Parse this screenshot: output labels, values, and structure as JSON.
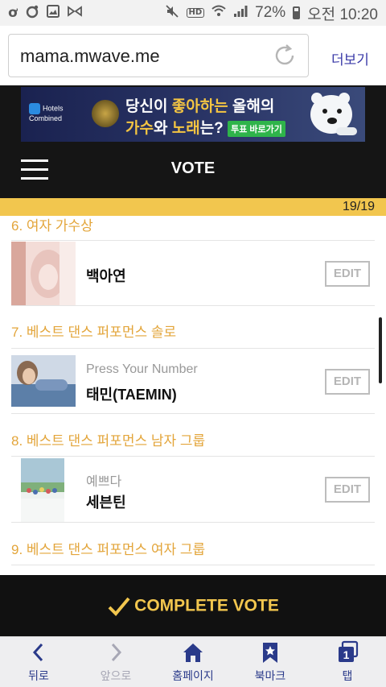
{
  "status_bar": {
    "battery": "72%",
    "time": "오전 10:20",
    "icons": [
      "o-icon",
      "circle-dot-icon",
      "image-icon",
      "bowtie-icon",
      "mute-icon",
      "hd-icon",
      "wifi-icon",
      "signal-icon",
      "battery-icon"
    ]
  },
  "browser": {
    "url": "mama.mwave.me",
    "more_label": "더보기"
  },
  "banner": {
    "hc_brand": "Hotels Combined",
    "line1_prefix": "당신이 ",
    "line1_highlight": "좋아하는",
    "line1_suffix": " 올해의",
    "line2_highlight1": "가수",
    "line2_mid": "와 ",
    "line2_highlight2": "노래",
    "line2_suffix": "는?",
    "button_label": "투표 바로가기"
  },
  "header": {
    "title": "VOTE"
  },
  "progress": {
    "text": "19/19"
  },
  "categories": [
    {
      "label": "6.  여자 가수상"
    },
    {
      "label": "7.  베스트 댄스 퍼포먼스 솔로"
    },
    {
      "label": "8.  베스트 댄스 퍼포먼스 남자 그룹"
    },
    {
      "label": "9.  베스트 댄스 퍼포먼스 여자 그룹"
    }
  ],
  "nominees": [
    {
      "sub": "",
      "name": "백아연",
      "edit_label": "EDIT"
    },
    {
      "sub": "Press Your Number",
      "name": "태민(TAEMIN)",
      "edit_label": "EDIT"
    },
    {
      "sub": "예쁘다",
      "name": "세븐틴",
      "edit_label": "EDIT"
    }
  ],
  "complete_label": "COMPLETE VOTE",
  "bottom_nav": [
    {
      "label": "뒤로",
      "icon": "back-arrow-icon"
    },
    {
      "label": "앞으로",
      "icon": "forward-arrow-icon"
    },
    {
      "label": "홈페이지",
      "icon": "home-icon"
    },
    {
      "label": "북마크",
      "icon": "bookmark-star-icon"
    },
    {
      "label": "탭",
      "icon": "tabs-icon",
      "count": "1"
    }
  ],
  "colors": {
    "accent": "#f2c64e",
    "category": "#e3a53a",
    "header_bg": "#151515",
    "nav_text": "#2a3a8a"
  }
}
